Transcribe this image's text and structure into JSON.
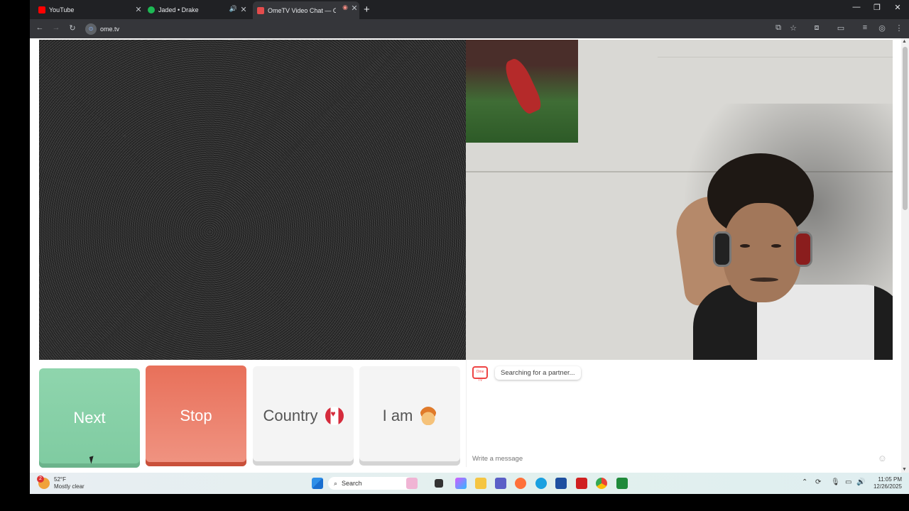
{
  "browser": {
    "tabs": [
      {
        "title": "YouTube",
        "favicon": "youtube-icon",
        "color": "#ff0000"
      },
      {
        "title": "Jaded • Drake",
        "favicon": "spotify-icon",
        "color": "#1db954"
      },
      {
        "title": "OmeTV Video Chat — Ome",
        "favicon": "ometv-icon",
        "color": "#e44c4c",
        "active": true
      }
    ],
    "url": "ome.tv"
  },
  "controls": {
    "next_label": "Next",
    "stop_label": "Stop",
    "country_label": "Country",
    "iam_label": "I am"
  },
  "chat": {
    "logo_text": "Ome TV",
    "status": "Searching for a partner...",
    "input_placeholder": "Write a message"
  },
  "taskbar": {
    "weather_badge": "2",
    "temperature": "52°F",
    "weather_desc": "Mostly clear",
    "search_label": "Search",
    "time": "11:05 PM",
    "date": "12/26/2025"
  },
  "colors": {
    "next": "#8fd5ad",
    "stop": "#e8705a",
    "neutral": "#f4f4f4"
  }
}
